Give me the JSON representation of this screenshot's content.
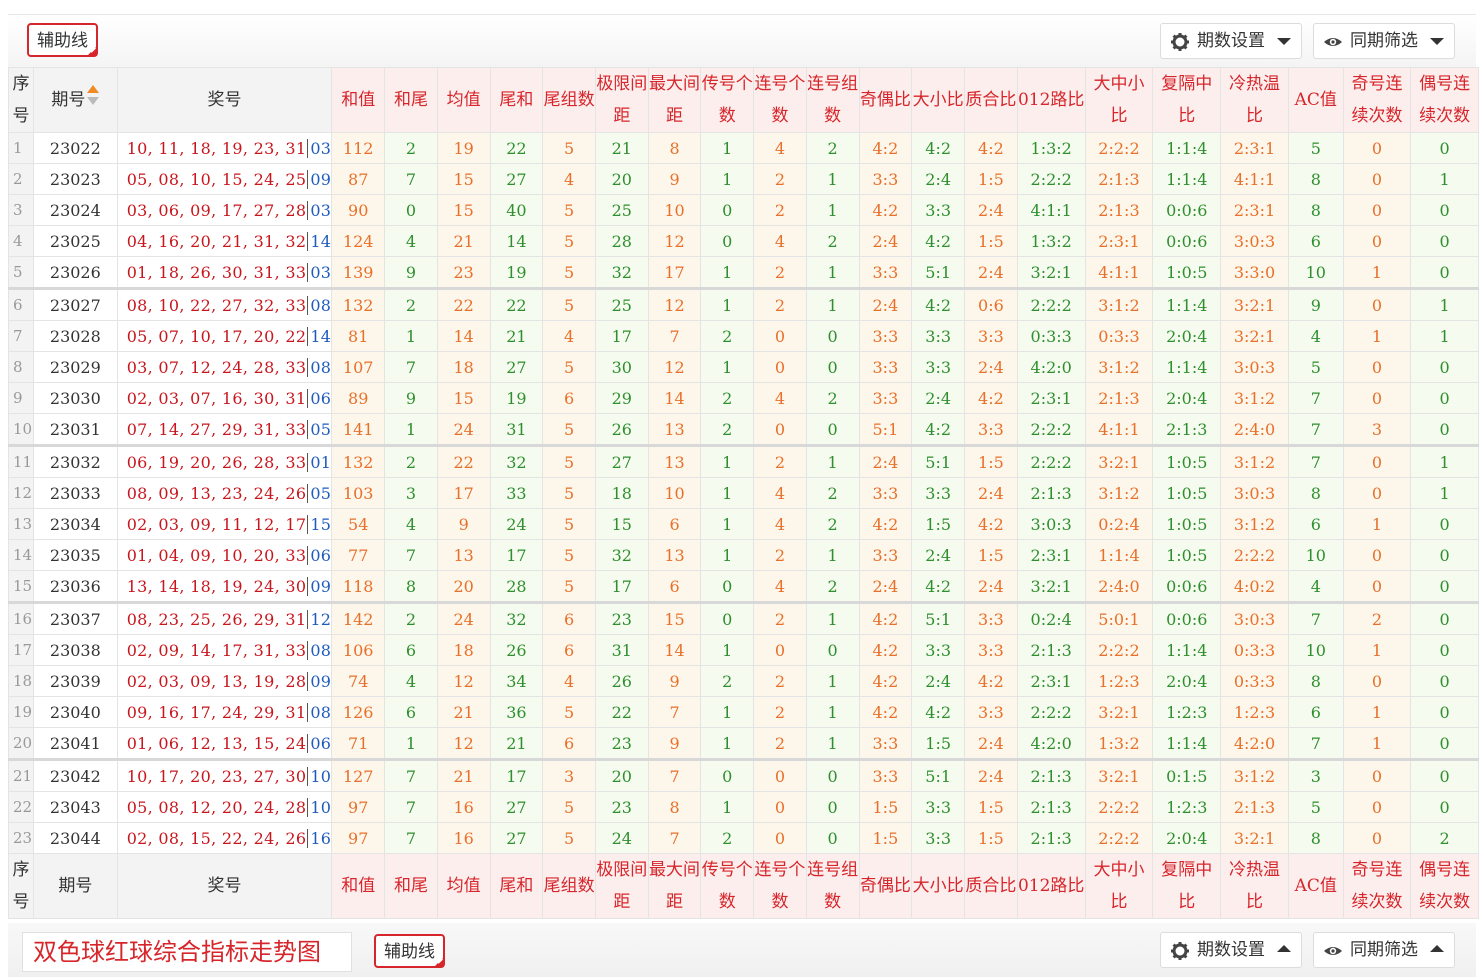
{
  "toolbar": {
    "aux_label": "辅助线",
    "period_settings": "期数设置",
    "same_period_filter": "同期筛选"
  },
  "footer": {
    "title": "双色球红球综合指标走势图",
    "aux_label": "辅助线",
    "period_settings": "期数设置",
    "same_period_filter": "同期筛选"
  },
  "columns": [
    "序号",
    "期号",
    "奖号",
    "和值",
    "和尾",
    "均值",
    "尾和",
    "尾组数",
    "极限间距",
    "最大间距",
    "传号个数",
    "连号个数",
    "连号组数",
    "奇偶比",
    "大小比",
    "质合比",
    "012路比",
    "大中小比",
    "复隔中比",
    "冷热温比",
    "AC值",
    "奇号连续次数",
    "偶号连续次数"
  ],
  "rows": [
    {
      "seq": "1",
      "issue": "23022",
      "reds": "10, 11, 18, 19, 23, 31",
      "blue": "03",
      "v": [
        "112",
        "2",
        "19",
        "22",
        "5",
        "21",
        "8",
        "1",
        "4",
        "2",
        "4:2",
        "4:2",
        "4:2",
        "1:3:2",
        "2:2:2",
        "1:1:4",
        "2:3:1",
        "5",
        "0",
        "0"
      ]
    },
    {
      "seq": "2",
      "issue": "23023",
      "reds": "05, 08, 10, 15, 24, 25",
      "blue": "09",
      "v": [
        "87",
        "7",
        "15",
        "27",
        "4",
        "20",
        "9",
        "1",
        "2",
        "1",
        "3:3",
        "2:4",
        "1:5",
        "2:2:2",
        "2:1:3",
        "1:1:4",
        "4:1:1",
        "8",
        "0",
        "1"
      ]
    },
    {
      "seq": "3",
      "issue": "23024",
      "reds": "03, 06, 09, 17, 27, 28",
      "blue": "03",
      "v": [
        "90",
        "0",
        "15",
        "40",
        "5",
        "25",
        "10",
        "0",
        "2",
        "1",
        "4:2",
        "3:3",
        "2:4",
        "4:1:1",
        "2:1:3",
        "0:0:6",
        "2:3:1",
        "8",
        "0",
        "0"
      ]
    },
    {
      "seq": "4",
      "issue": "23025",
      "reds": "04, 16, 20, 21, 31, 32",
      "blue": "14",
      "v": [
        "124",
        "4",
        "21",
        "14",
        "5",
        "28",
        "12",
        "0",
        "4",
        "2",
        "2:4",
        "4:2",
        "1:5",
        "1:3:2",
        "2:3:1",
        "0:0:6",
        "3:0:3",
        "6",
        "0",
        "0"
      ]
    },
    {
      "seq": "5",
      "issue": "23026",
      "reds": "01, 18, 26, 30, 31, 33",
      "blue": "03",
      "v": [
        "139",
        "9",
        "23",
        "19",
        "5",
        "32",
        "17",
        "1",
        "2",
        "1",
        "3:3",
        "5:1",
        "2:4",
        "3:2:1",
        "4:1:1",
        "1:0:5",
        "3:3:0",
        "10",
        "1",
        "0"
      ]
    },
    {
      "seq": "6",
      "issue": "23027",
      "reds": "08, 10, 22, 27, 32, 33",
      "blue": "08",
      "v": [
        "132",
        "2",
        "22",
        "22",
        "5",
        "25",
        "12",
        "1",
        "2",
        "1",
        "2:4",
        "4:2",
        "0:6",
        "2:2:2",
        "3:1:2",
        "1:1:4",
        "3:2:1",
        "9",
        "0",
        "1"
      ]
    },
    {
      "seq": "7",
      "issue": "23028",
      "reds": "05, 07, 10, 17, 20, 22",
      "blue": "14",
      "v": [
        "81",
        "1",
        "14",
        "21",
        "4",
        "17",
        "7",
        "2",
        "0",
        "0",
        "3:3",
        "3:3",
        "3:3",
        "0:3:3",
        "0:3:3",
        "2:0:4",
        "3:2:1",
        "4",
        "1",
        "1"
      ]
    },
    {
      "seq": "8",
      "issue": "23029",
      "reds": "03, 07, 12, 24, 28, 33",
      "blue": "08",
      "v": [
        "107",
        "7",
        "18",
        "27",
        "5",
        "30",
        "12",
        "1",
        "0",
        "0",
        "3:3",
        "3:3",
        "2:4",
        "4:2:0",
        "3:1:2",
        "1:1:4",
        "3:0:3",
        "5",
        "0",
        "0"
      ]
    },
    {
      "seq": "9",
      "issue": "23030",
      "reds": "02, 03, 07, 16, 30, 31",
      "blue": "06",
      "v": [
        "89",
        "9",
        "15",
        "19",
        "6",
        "29",
        "14",
        "2",
        "4",
        "2",
        "3:3",
        "2:4",
        "4:2",
        "2:3:1",
        "2:1:3",
        "2:0:4",
        "3:1:2",
        "7",
        "0",
        "0"
      ]
    },
    {
      "seq": "10",
      "issue": "23031",
      "reds": "07, 14, 27, 29, 31, 33",
      "blue": "05",
      "v": [
        "141",
        "1",
        "24",
        "31",
        "5",
        "26",
        "13",
        "2",
        "0",
        "0",
        "5:1",
        "4:2",
        "3:3",
        "2:2:2",
        "4:1:1",
        "2:1:3",
        "2:4:0",
        "7",
        "3",
        "0"
      ]
    },
    {
      "seq": "11",
      "issue": "23032",
      "reds": "06, 19, 20, 26, 28, 33",
      "blue": "01",
      "v": [
        "132",
        "2",
        "22",
        "32",
        "5",
        "27",
        "13",
        "1",
        "2",
        "1",
        "2:4",
        "5:1",
        "1:5",
        "2:2:2",
        "3:2:1",
        "1:0:5",
        "3:1:2",
        "7",
        "0",
        "1"
      ]
    },
    {
      "seq": "12",
      "issue": "23033",
      "reds": "08, 09, 13, 23, 24, 26",
      "blue": "05",
      "v": [
        "103",
        "3",
        "17",
        "33",
        "5",
        "18",
        "10",
        "1",
        "4",
        "2",
        "3:3",
        "3:3",
        "2:4",
        "2:1:3",
        "3:1:2",
        "1:0:5",
        "3:0:3",
        "8",
        "0",
        "1"
      ]
    },
    {
      "seq": "13",
      "issue": "23034",
      "reds": "02, 03, 09, 11, 12, 17",
      "blue": "15",
      "v": [
        "54",
        "4",
        "9",
        "24",
        "5",
        "15",
        "6",
        "1",
        "4",
        "2",
        "4:2",
        "1:5",
        "4:2",
        "3:0:3",
        "0:2:4",
        "1:0:5",
        "3:1:2",
        "6",
        "1",
        "0"
      ]
    },
    {
      "seq": "14",
      "issue": "23035",
      "reds": "01, 04, 09, 10, 20, 33",
      "blue": "06",
      "v": [
        "77",
        "7",
        "13",
        "17",
        "5",
        "32",
        "13",
        "1",
        "2",
        "1",
        "3:3",
        "2:4",
        "1:5",
        "2:3:1",
        "1:1:4",
        "1:0:5",
        "2:2:2",
        "10",
        "0",
        "0"
      ]
    },
    {
      "seq": "15",
      "issue": "23036",
      "reds": "13, 14, 18, 19, 24, 30",
      "blue": "09",
      "v": [
        "118",
        "8",
        "20",
        "28",
        "5",
        "17",
        "6",
        "0",
        "4",
        "2",
        "2:4",
        "4:2",
        "2:4",
        "3:2:1",
        "2:4:0",
        "0:0:6",
        "4:0:2",
        "4",
        "0",
        "0"
      ]
    },
    {
      "seq": "16",
      "issue": "23037",
      "reds": "08, 23, 25, 26, 29, 31",
      "blue": "12",
      "v": [
        "142",
        "2",
        "24",
        "32",
        "6",
        "23",
        "15",
        "0",
        "2",
        "1",
        "4:2",
        "5:1",
        "3:3",
        "0:2:4",
        "5:0:1",
        "0:0:6",
        "3:0:3",
        "7",
        "2",
        "0"
      ]
    },
    {
      "seq": "17",
      "issue": "23038",
      "reds": "02, 09, 14, 17, 31, 33",
      "blue": "08",
      "v": [
        "106",
        "6",
        "18",
        "26",
        "6",
        "31",
        "14",
        "1",
        "0",
        "0",
        "4:2",
        "3:3",
        "3:3",
        "2:1:3",
        "2:2:2",
        "1:1:4",
        "0:3:3",
        "10",
        "1",
        "0"
      ]
    },
    {
      "seq": "18",
      "issue": "23039",
      "reds": "02, 03, 09, 13, 19, 28",
      "blue": "09",
      "v": [
        "74",
        "4",
        "12",
        "34",
        "4",
        "26",
        "9",
        "2",
        "2",
        "1",
        "4:2",
        "2:4",
        "4:2",
        "2:3:1",
        "1:2:3",
        "2:0:4",
        "0:3:3",
        "8",
        "0",
        "0"
      ]
    },
    {
      "seq": "19",
      "issue": "23040",
      "reds": "09, 16, 17, 24, 29, 31",
      "blue": "08",
      "v": [
        "126",
        "6",
        "21",
        "36",
        "5",
        "22",
        "7",
        "1",
        "2",
        "1",
        "4:2",
        "4:2",
        "3:3",
        "2:2:2",
        "3:2:1",
        "1:2:3",
        "1:2:3",
        "6",
        "1",
        "0"
      ]
    },
    {
      "seq": "20",
      "issue": "23041",
      "reds": "01, 06, 12, 13, 15, 24",
      "blue": "06",
      "v": [
        "71",
        "1",
        "12",
        "21",
        "6",
        "23",
        "9",
        "1",
        "2",
        "1",
        "3:3",
        "1:5",
        "2:4",
        "4:2:0",
        "1:3:2",
        "1:1:4",
        "4:2:0",
        "7",
        "1",
        "0"
      ]
    },
    {
      "seq": "21",
      "issue": "23042",
      "reds": "10, 17, 20, 23, 27, 30",
      "blue": "10",
      "v": [
        "127",
        "7",
        "21",
        "17",
        "3",
        "20",
        "7",
        "0",
        "0",
        "0",
        "3:3",
        "5:1",
        "2:4",
        "2:1:3",
        "3:2:1",
        "0:1:5",
        "3:1:2",
        "3",
        "0",
        "0"
      ]
    },
    {
      "seq": "22",
      "issue": "23043",
      "reds": "05, 08, 12, 20, 24, 28",
      "blue": "10",
      "v": [
        "97",
        "7",
        "16",
        "27",
        "5",
        "23",
        "8",
        "1",
        "0",
        "0",
        "1:5",
        "3:3",
        "1:5",
        "2:1:3",
        "2:2:2",
        "1:2:3",
        "2:1:3",
        "5",
        "0",
        "0"
      ]
    },
    {
      "seq": "23",
      "issue": "23044",
      "reds": "02, 08, 15, 22, 24, 26",
      "blue": "16",
      "v": [
        "97",
        "7",
        "16",
        "27",
        "5",
        "24",
        "7",
        "2",
        "0",
        "0",
        "1:5",
        "3:3",
        "1:5",
        "2:1:3",
        "2:2:2",
        "2:0:4",
        "3:2:1",
        "8",
        "0",
        "2"
      ]
    }
  ],
  "colors": {
    "red": "#d6262b",
    "blue": "#1e5bbd",
    "orange": "#e8702a",
    "green": "#2f8f2f"
  }
}
